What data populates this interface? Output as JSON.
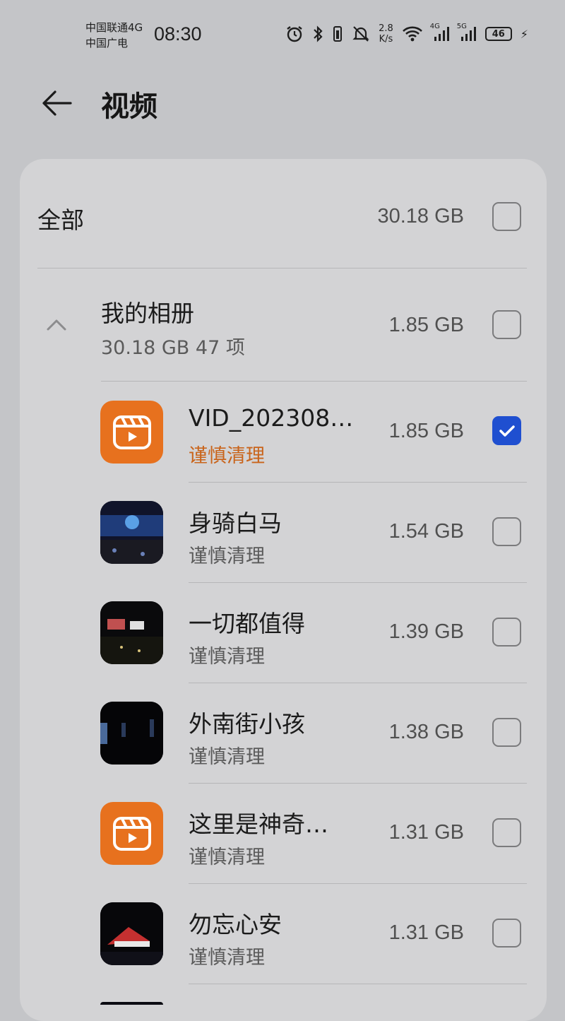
{
  "status": {
    "carrier1": "中国联通4G",
    "carrier2": "中国广电",
    "time": "08:30",
    "speed_value": "2.8",
    "speed_unit": "K/s",
    "net1": "4G",
    "net2": "5G",
    "battery": "46"
  },
  "header": {
    "title": "视频"
  },
  "all": {
    "label": "全部",
    "size": "30.18 GB",
    "checked": false
  },
  "album": {
    "title": "我的相册",
    "subtitle": "30.18 GB 47 项",
    "size": "1.85 GB",
    "checked": false
  },
  "items": [
    {
      "name": "VID_202308…",
      "note": "谨慎清理",
      "size": "1.85 GB",
      "thumb": "video-app-icon",
      "checked": true,
      "note_color": "#c9641b"
    },
    {
      "name": "身骑白马",
      "note": "谨慎清理",
      "size": "1.54 GB",
      "thumb": "concert-photo",
      "checked": false
    },
    {
      "name": "一切都值得",
      "note": "谨慎清理",
      "size": "1.39 GB",
      "thumb": "concert-photo",
      "checked": false
    },
    {
      "name": "外南街小孩",
      "note": "谨慎清理",
      "size": "1.38 GB",
      "thumb": "concert-photo",
      "checked": false
    },
    {
      "name": "这里是神奇…",
      "note": "谨慎清理",
      "size": "1.31 GB",
      "thumb": "video-app-icon",
      "checked": false
    },
    {
      "name": "勿忘心安",
      "note": "谨慎清理",
      "size": "1.31 GB",
      "thumb": "concert-photo",
      "checked": false
    }
  ]
}
